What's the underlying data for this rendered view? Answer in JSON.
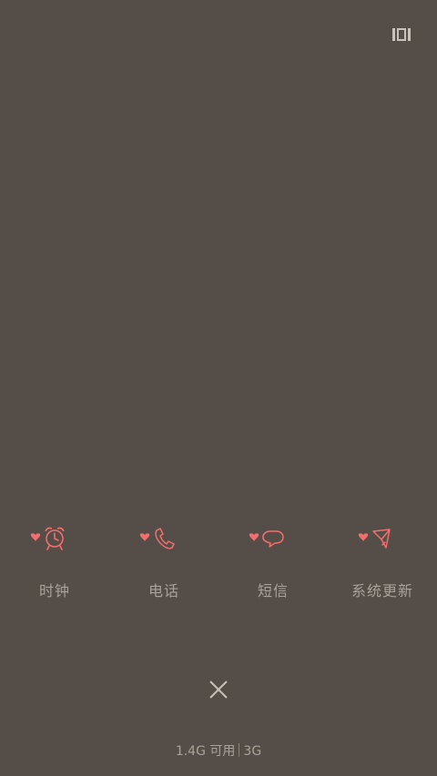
{
  "top_right_icon": "recent-apps-icon",
  "shortcuts": [
    {
      "label": "时钟",
      "icon": "alarm-clock-icon"
    },
    {
      "label": "电话",
      "icon": "phone-icon"
    },
    {
      "label": "短信",
      "icon": "message-icon"
    },
    {
      "label": "系统更新",
      "icon": "paper-plane-icon"
    }
  ],
  "close_icon": "close-icon",
  "status": {
    "memory": "1.4G 可用",
    "network": "3G"
  },
  "colors": {
    "background": "#554d47",
    "accent": "#f26f6f",
    "label": "#a9a29b"
  }
}
